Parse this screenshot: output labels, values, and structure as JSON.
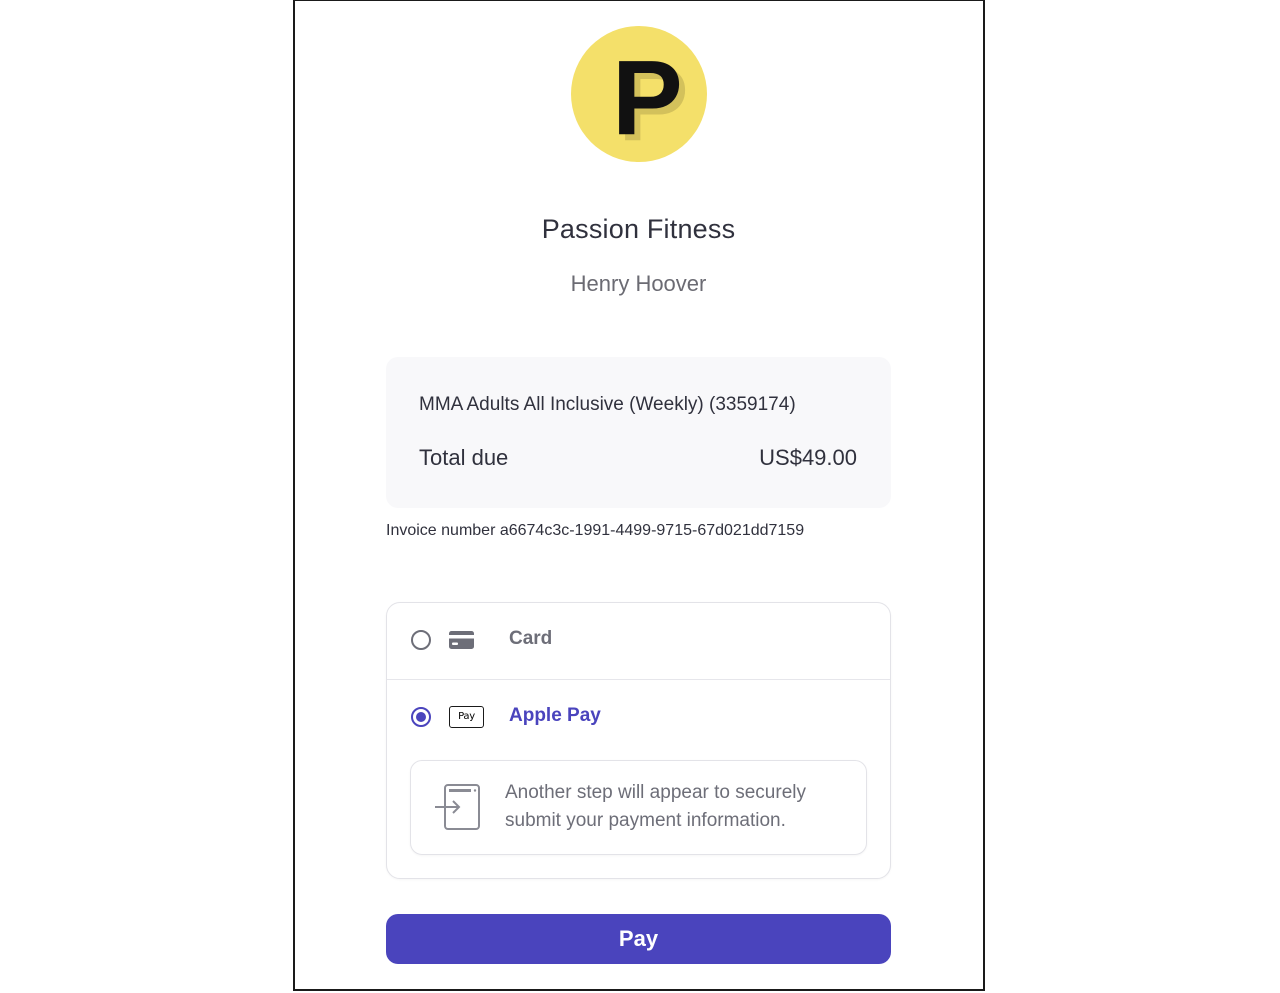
{
  "merchant": {
    "logo_letter": "P",
    "logo_color": "#f4e06a",
    "name": "Passion Fitness",
    "customer_name": "Henry Hoover"
  },
  "summary": {
    "line_item": "MMA Adults All Inclusive (Weekly) (3359174)",
    "total_label": "Total due",
    "total_value": "US$49.00"
  },
  "invoice": {
    "text": "Invoice number a6674c3c-1991-4499-9715-67d021dd7159"
  },
  "payment_methods": {
    "card": {
      "label": "Card",
      "icon": "credit-card-icon",
      "selected": false
    },
    "apple_pay": {
      "label": "Apple Pay",
      "icon": "apple-pay-icon",
      "icon_text": "Pay",
      "selected": true,
      "notice": "Another step will appear to securely submit your payment information.",
      "notice_icon": "redirect-icon"
    }
  },
  "pay_button": {
    "label": "Pay",
    "color": "#4a44bd"
  }
}
